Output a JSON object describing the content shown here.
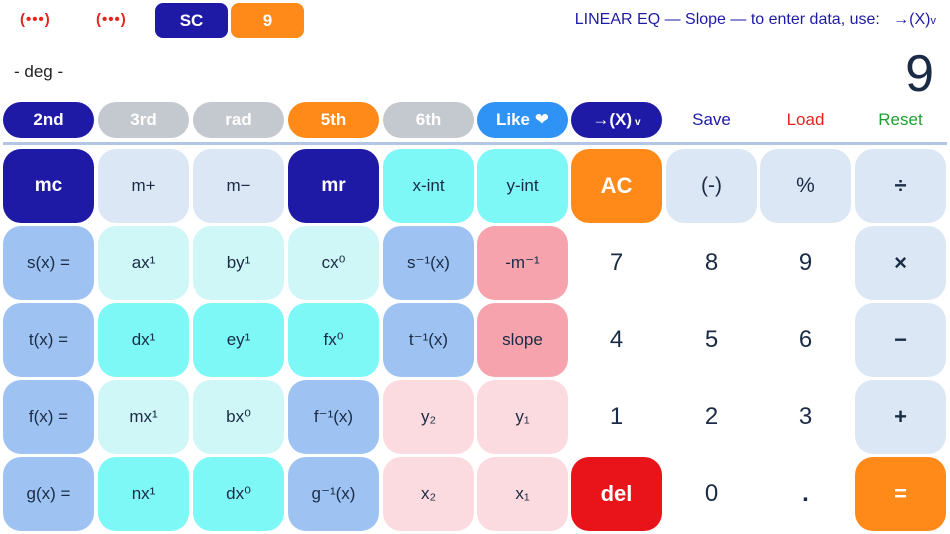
{
  "top": {
    "dots1": "(•••)",
    "dots2": "(•••)",
    "mode_chip": "SC",
    "count_chip": "9",
    "info_text": "LINEAR EQ — Slope — to enter data, use:",
    "info_arrow": "→(X)",
    "info_sub": "v"
  },
  "status": {
    "angle": "- deg -",
    "display": "9"
  },
  "func_row": {
    "b2nd": "2nd",
    "b3rd": "3rd",
    "brad": "rad",
    "b5th": "5th",
    "b6th": "6th",
    "like": "Like ❤",
    "arrow": "→(X)",
    "arrow_sub": "v",
    "save": "Save",
    "load": "Load",
    "reset": "Reset"
  },
  "keys": {
    "r1": [
      "mc",
      "m+",
      "m−",
      "mr",
      "x-int",
      "y-int",
      "AC",
      "(-)",
      "%",
      "÷"
    ],
    "r2": [
      "s(x) =",
      "ax¹",
      "by¹",
      "cx⁰",
      "s⁻¹(x)",
      "-m⁻¹",
      "7",
      "8",
      "9",
      "×"
    ],
    "r3": [
      "t(x) =",
      "dx¹",
      "ey¹",
      "fx⁰",
      "t⁻¹(x)",
      "slope",
      "4",
      "5",
      "6",
      "−"
    ],
    "r4": [
      "f(x) =",
      "mx¹",
      "bx⁰",
      "f⁻¹(x)",
      "y₂",
      "y₁",
      "1",
      "2",
      "3",
      "+"
    ],
    "r5": [
      "g(x) =",
      "nx¹",
      "dx⁰",
      "g⁻¹(x)",
      "x₂",
      "x₁",
      "del",
      "0",
      ".",
      "="
    ]
  }
}
